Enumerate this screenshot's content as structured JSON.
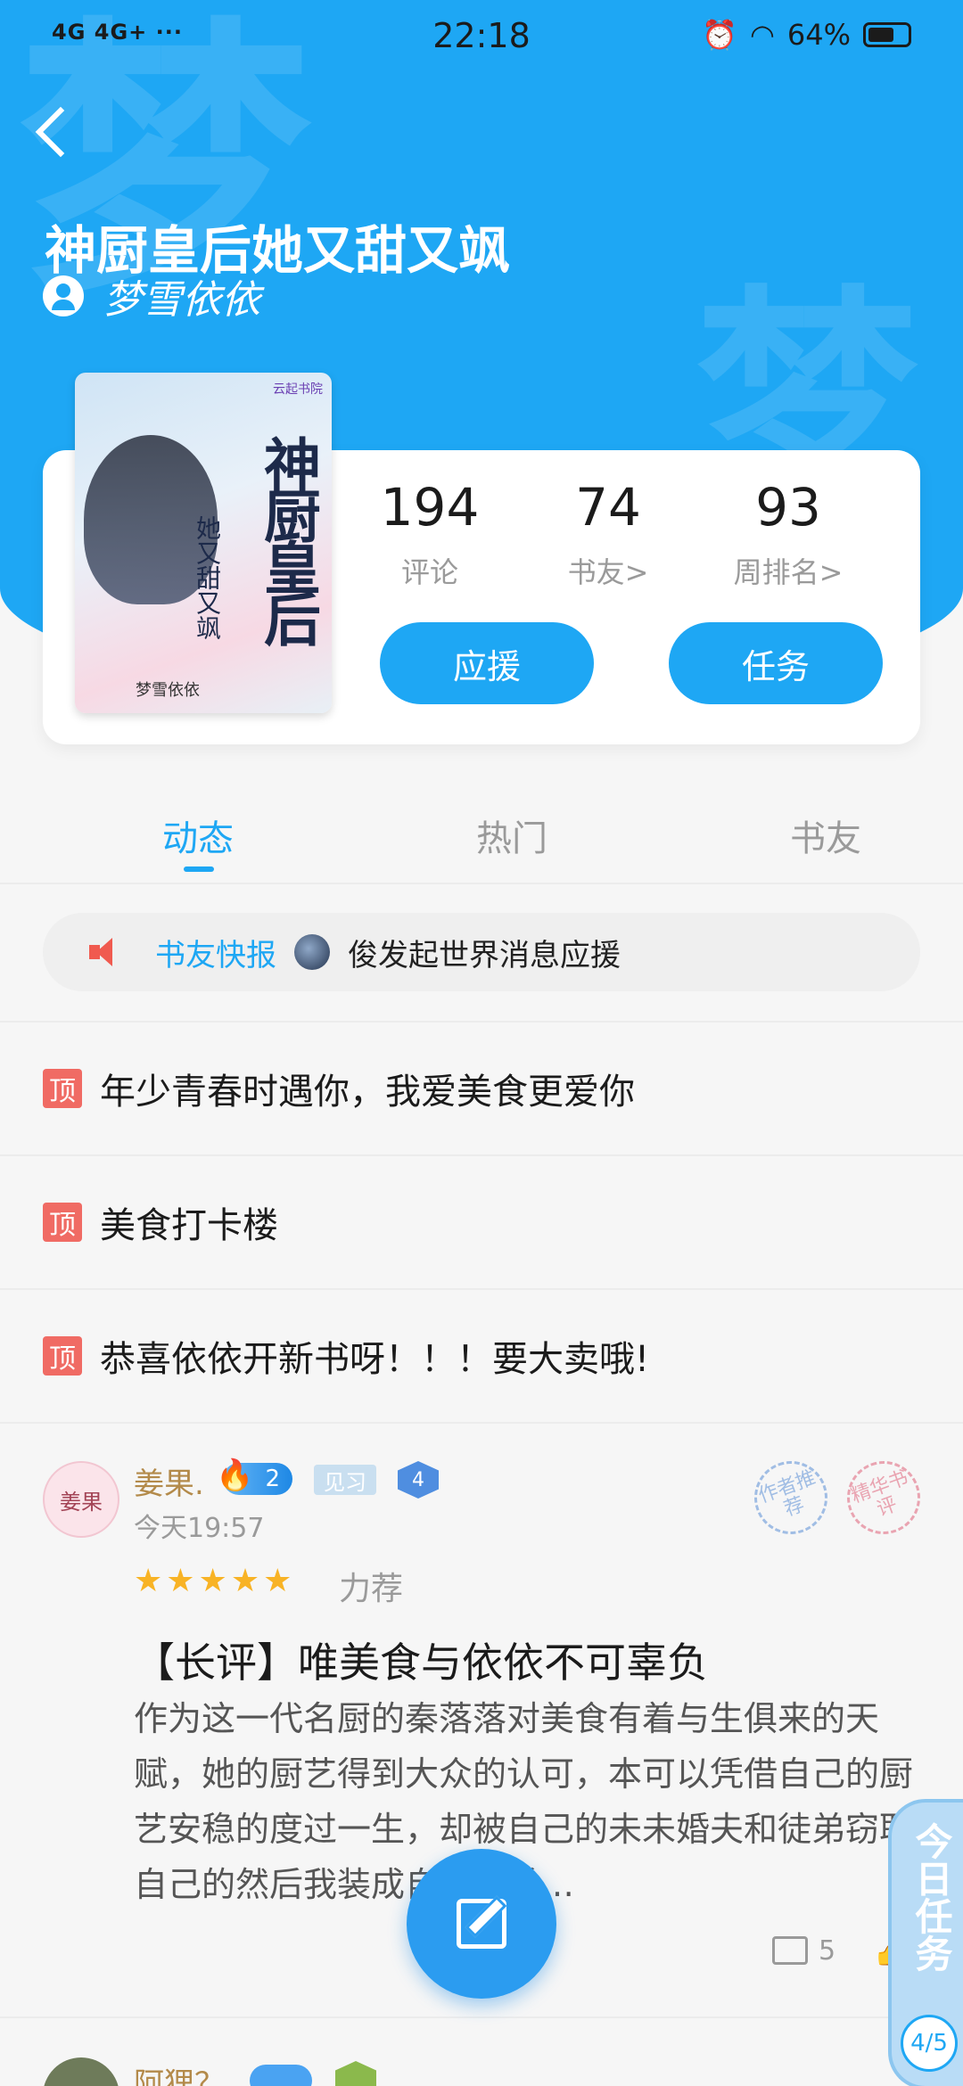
{
  "status_bar": {
    "signal_text": "4G 4G+ ···",
    "time": "22:18",
    "battery": "64%"
  },
  "header": {
    "title": "神厨皇后她又甜又飒",
    "author": "梦雪依依",
    "watermark_1": "梦",
    "watermark_2": "梦",
    "accent_color": "#1ea7f4"
  },
  "cover": {
    "title": "神厨皇后",
    "subtitle": "她又甜又飒",
    "author": "梦雪依依",
    "publisher": "云起书院"
  },
  "stats": [
    {
      "value": "194",
      "label": "评论"
    },
    {
      "value": "74",
      "label": "书友>"
    },
    {
      "value": "93",
      "label": "周排名>"
    }
  ],
  "actions": {
    "support": "应援",
    "task": "任务"
  },
  "tabs": [
    {
      "label": "动态",
      "active": true
    },
    {
      "label": "热门",
      "active": false
    },
    {
      "label": "书友",
      "active": false
    }
  ],
  "news": {
    "tag": "书友快报",
    "text": "俊发起世界消息应援"
  },
  "pinned": [
    {
      "tag": "顶",
      "text": "年少青春时遇你，我爱美食更爱你"
    },
    {
      "tag": "顶",
      "text": "美食打卡楼"
    },
    {
      "tag": "顶",
      "text": "恭喜依依开新书呀！！！要大卖哦!"
    }
  ],
  "post": {
    "avatar_text": "姜果",
    "username": "姜果.",
    "fire_level": "2",
    "rank_label": "见习",
    "badge_level": "4",
    "time": "今天19:57",
    "stamp_1": "作者推荐",
    "stamp_2": "精华书评",
    "rating": "★★★★★",
    "rating_label": "力荐",
    "title": "【长评】唯美食与依依不可辜负",
    "body": "作为这一代名厨的秦落落对美食有着与生俱来的天赋，她的厨艺得到大众的认可，本可以凭借自己的厨艺安稳的度过一生，却被自己的未未婚夫和徒弟窃取自己的然后我装成自己自杀…",
    "comments": "5"
  },
  "next_post": {
    "username": "阿狸？"
  },
  "floating": {
    "task_side": "今日任务",
    "task_count": "4/5"
  }
}
